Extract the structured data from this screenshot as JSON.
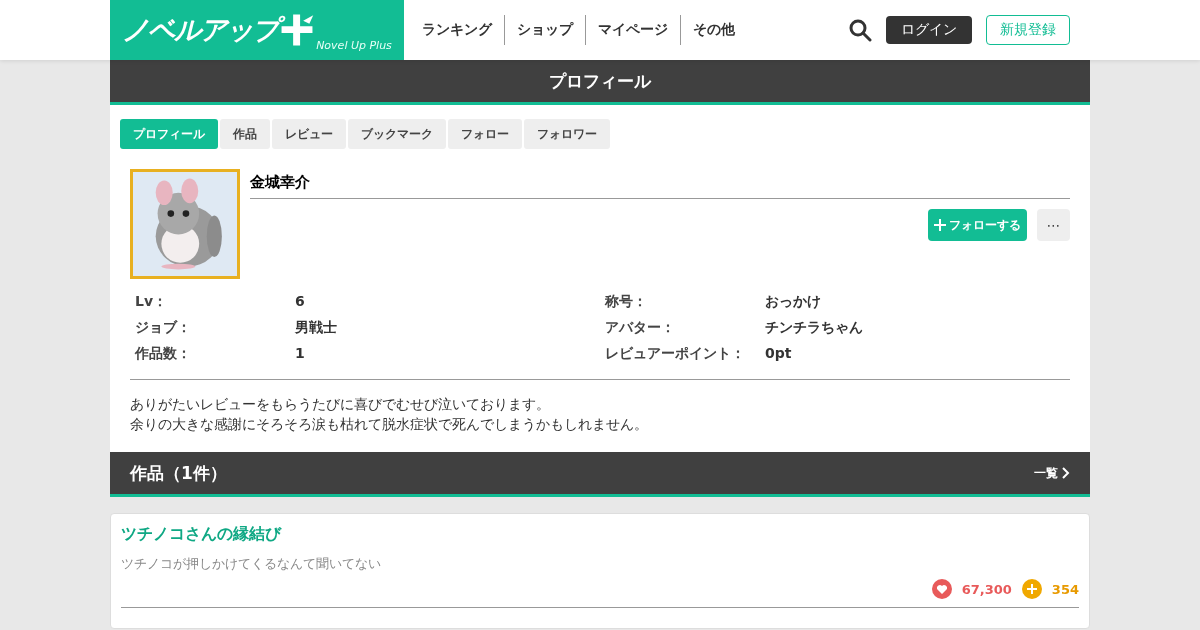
{
  "header": {
    "logo": {
      "title": "ノベルアップ",
      "subtitle": "Novel Up Plus"
    },
    "nav": [
      "ランキング",
      "ショップ",
      "マイページ",
      "その他"
    ],
    "login": "ログイン",
    "register": "新規登録"
  },
  "page_title": "プロフィール",
  "tabs": [
    {
      "label": "プロフィール",
      "selected": true
    },
    {
      "label": "作品",
      "selected": false
    },
    {
      "label": "レビュー",
      "selected": false
    },
    {
      "label": "ブックマーク",
      "selected": false
    },
    {
      "label": "フォロー",
      "selected": false
    },
    {
      "label": "フォロワー",
      "selected": false
    }
  ],
  "profile": {
    "name": "金城幸介",
    "follow_button": "フォローする",
    "more_button": "⋯",
    "stats": [
      {
        "label": "Lv：",
        "value": "6"
      },
      {
        "label": "称号：",
        "value": "おっかけ"
      },
      {
        "label": "ジョブ：",
        "value": "男戦士"
      },
      {
        "label": "アバター：",
        "value": "チンチラちゃん"
      },
      {
        "label": "作品数：",
        "value": "1"
      },
      {
        "label": "レビュアーポイント：",
        "value": "0pt"
      }
    ],
    "bio": [
      "ありがたいレビューをもらうたびに喜びでむせび泣いております。",
      "余りの大きな感謝にそろそろ涙も枯れて脱水症状で死んでしまうかもしれません。"
    ]
  },
  "works_section": {
    "title": "作品（1件）",
    "more_link": "一覧"
  },
  "works": [
    {
      "title": "ツチノコさんの縁結び",
      "catch": "ツチノコが押しかけてくるなんて聞いてない",
      "likes": "67,300",
      "points": "354"
    }
  ]
}
